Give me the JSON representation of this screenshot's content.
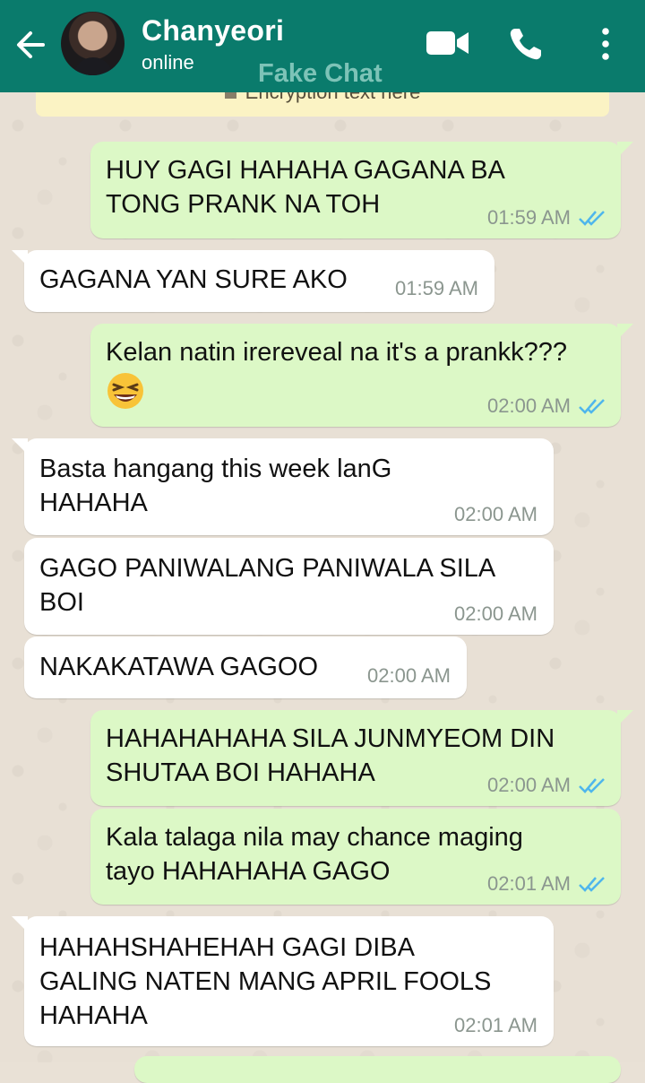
{
  "header": {
    "contact_name": "Chanyeori",
    "contact_status": "online",
    "watermark": "Fake Chat",
    "back_icon": "arrow-left-icon",
    "video_icon": "video-camera-icon",
    "call_icon": "phone-icon",
    "menu_icon": "more-vertical-icon",
    "color": "#0a7b6c"
  },
  "encryption_banner": {
    "text": "Encryption text here"
  },
  "messages": [
    {
      "direction": "out",
      "text": "HUY GAGI HAHAHA GAGANA BA\nTONG PRANK NA TOH",
      "time": "01:59 AM",
      "read": true
    },
    {
      "direction": "in",
      "text": "GAGANA YAN SURE AKO",
      "time": "01:59 AM"
    },
    {
      "direction": "out",
      "text": "Kelan natin irereveal na it's a prankk???",
      "emoji": "grinning-squinting-face",
      "time": "02:00 AM",
      "read": true
    },
    {
      "direction": "in",
      "text": "Basta hangang this week lanG\nHAHAHA",
      "time": "02:00 AM"
    },
    {
      "direction": "in",
      "text": "GAGO PANIWALANG PANIWALA SILA\nBOI",
      "time": "02:00 AM"
    },
    {
      "direction": "in",
      "text": "NAKAKATAWA GAGOO",
      "time": "02:00 AM"
    },
    {
      "direction": "out",
      "text": "HAHAHAHAHA SILA JUNMYEOM DIN\nSHUTAA BOI HAHAHA",
      "time": "02:00 AM",
      "read": true
    },
    {
      "direction": "out",
      "text": "Kala talaga nila may chance maging\ntayo HAHAHAHA GAGO",
      "time": "02:01 AM",
      "read": true
    },
    {
      "direction": "in",
      "text": "HAHAHSHAHEHAH GAGI DIBA\nGALING NATEN MANG APRIL FOOLS\nHAHAHA",
      "time": "02:01 AM"
    }
  ],
  "colors": {
    "outgoing_bubble": "#dcf8c6",
    "incoming_bubble": "#ffffff",
    "read_ticks": "#4fb6ec"
  }
}
